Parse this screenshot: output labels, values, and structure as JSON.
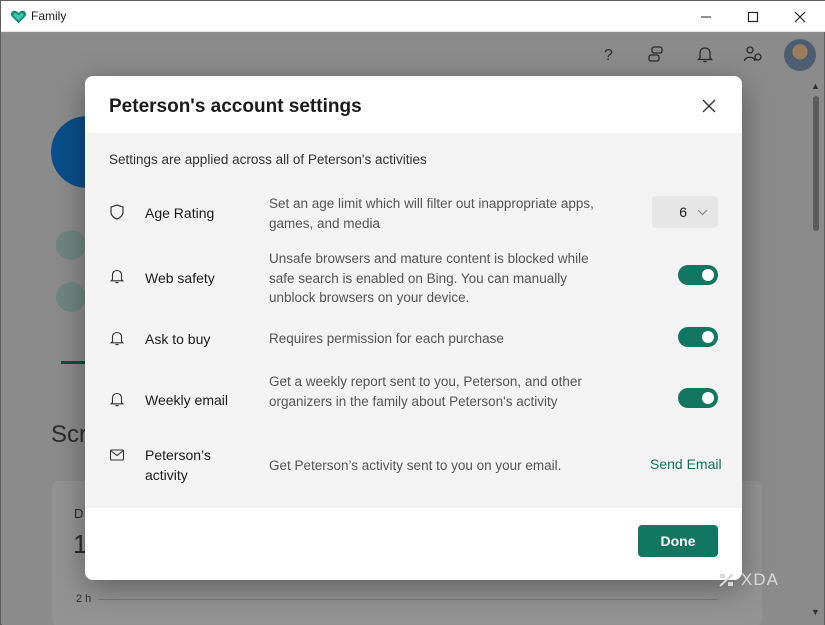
{
  "window": {
    "app_title": "Family",
    "controls": {
      "minimize": "—",
      "maximize": "☐",
      "close": "✕"
    }
  },
  "header_icons": [
    "help-icon",
    "share-icon",
    "bell-icon",
    "people-settings-icon",
    "avatar"
  ],
  "background": {
    "heading_partial": "Scr",
    "card_label_partial": "D",
    "card_value_partial": "1",
    "axis_label": "2 h"
  },
  "dialog": {
    "title": "Peterson's account settings",
    "intro": "Settings are applied across all of Peterson's activities",
    "rows": [
      {
        "icon": "shield-icon",
        "label": "Age Rating",
        "description": "Set an age limit which will filter out inappropriate apps, games, and media",
        "control": "select",
        "value": "6"
      },
      {
        "icon": "bell-icon",
        "label": "Web safety",
        "description": "Unsafe browsers and mature content is blocked while safe search is enabled on Bing. You can manually unblock browsers on your device.",
        "control": "toggle",
        "value": "on"
      },
      {
        "icon": "bell-icon",
        "label": "Ask to buy",
        "description": "Requires permission for each purchase",
        "control": "toggle",
        "value": "on"
      },
      {
        "icon": "bell-icon",
        "label": "Weekly email",
        "description": "Get a weekly report sent to you, Peterson, and other organizers in the family about Peterson's activity",
        "control": "toggle",
        "value": "on"
      },
      {
        "icon": "mail-icon",
        "label": "Peterson’s activity",
        "description": "Get Peterson’s activity sent to you on your email.",
        "control": "link",
        "value": "Send Email"
      }
    ],
    "done_label": "Done"
  },
  "watermark": "XDA",
  "colors": {
    "accent": "#127660",
    "link": "#137060",
    "overlay": "#8b8b8b"
  }
}
